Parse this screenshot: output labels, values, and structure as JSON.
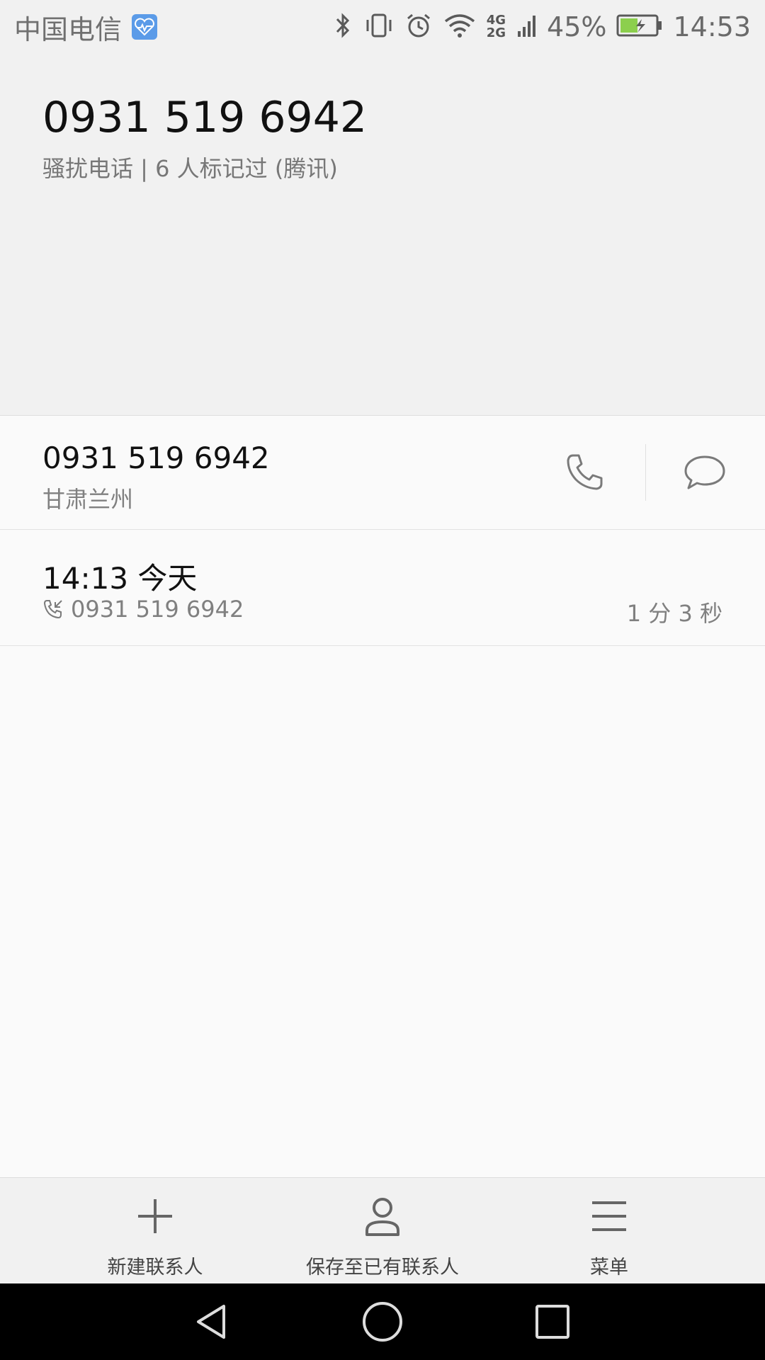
{
  "status_bar": {
    "carrier": "中国电信",
    "network_top": "4G",
    "network_bottom": "2G",
    "battery": "45%",
    "time": "14:53",
    "icons": [
      "health-icon",
      "bluetooth-icon",
      "vibrate-icon",
      "alarm-icon",
      "wifi-icon",
      "signal-icon",
      "battery-icon"
    ]
  },
  "header": {
    "number": "0931 519 6942",
    "tag": "骚扰电话 | 6 人标记过 (腾讯)"
  },
  "number_row": {
    "number": "0931 519 6942",
    "location": "甘肃兰州"
  },
  "call_log": {
    "time": "14:13 今天",
    "number": "0931 519 6942",
    "duration": "1 分 3 秒"
  },
  "actions": {
    "new_contact": "新建联系人",
    "save_existing": "保存至已有联系人",
    "menu": "菜单"
  },
  "colors": {
    "background": "#fafafa",
    "header_bg": "#f1f1f1",
    "icon_gray": "#7a7a7a",
    "battery_green": "#8ccf4d"
  }
}
